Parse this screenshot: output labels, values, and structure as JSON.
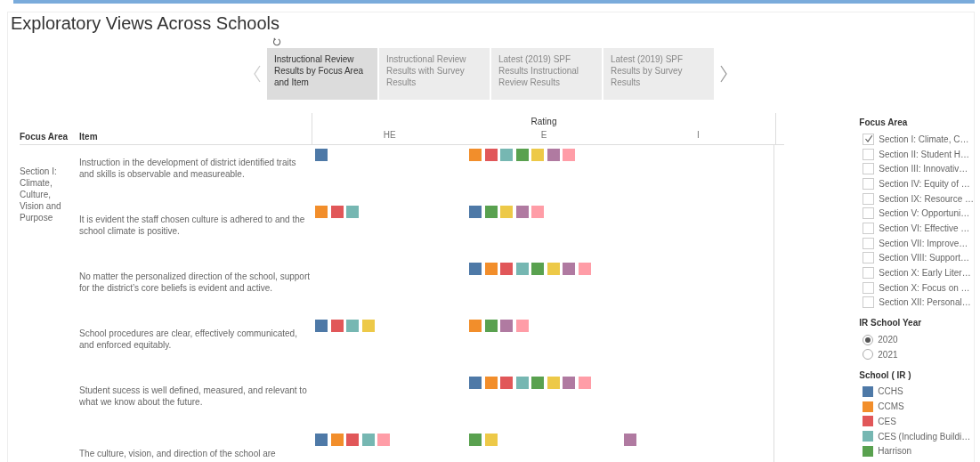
{
  "title": "Exploratory Views Across Schools",
  "tabs": [
    {
      "label": "Instructional Review Results by Focus Area and Item",
      "selected": true
    },
    {
      "label": "Instructional Review Results with Survey Results",
      "selected": false
    },
    {
      "label": "Latest (2019) SPF Results Instructional Review Results",
      "selected": false
    },
    {
      "label": "Latest (2019) SPF Results by Survey Results",
      "selected": false
    }
  ],
  "table": {
    "columns": [
      "Focus Area",
      "Item"
    ],
    "rating_header": "Rating",
    "ratings": {
      "he": "HE",
      "e": "E",
      "i": "I"
    },
    "focus_area": "Section I: Climate, Culture, Vision and Purpose",
    "rows": [
      {
        "item": "Instruction in the development of district identified traits and skills is observable and measureable.",
        "marks": {
          "he": [
            {
              "color": "#4e79a7"
            }
          ],
          "e": [
            {
              "color": "#f28e2b"
            },
            {
              "color": "#e15759"
            },
            {
              "color": "#76b7b2"
            },
            {
              "color": "#59a14f"
            },
            {
              "color": "#edc948"
            },
            {
              "color": "#b07aa1"
            },
            {
              "color": "#ff9da7"
            }
          ]
        }
      },
      {
        "item": "It is evident the staff chosen culture is adhered to and the school climate is positive.",
        "marks": {
          "he": [
            {
              "color": "#f28e2b"
            },
            {
              "color": "#e15759"
            },
            {
              "color": "#76b7b2"
            }
          ],
          "e": [
            {
              "color": "#4e79a7"
            },
            {
              "color": "#59a14f"
            },
            {
              "color": "#edc948"
            },
            {
              "color": "#b07aa1"
            },
            {
              "color": "#ff9da7"
            }
          ]
        }
      },
      {
        "item": "No matter the personalized direction of the school, support for the district’s core beliefs is evident and active.",
        "marks": {
          "e": [
            {
              "color": "#4e79a7"
            },
            {
              "color": "#f28e2b"
            },
            {
              "color": "#e15759"
            },
            {
              "color": "#76b7b2"
            },
            {
              "color": "#59a14f"
            },
            {
              "color": "#edc948"
            },
            {
              "color": "#b07aa1"
            },
            {
              "color": "#ff9da7"
            }
          ]
        }
      },
      {
        "item": "School procedures are clear, effectively communicated, and enforced equitably.",
        "marks": {
          "he": [
            {
              "color": "#4e79a7"
            },
            {
              "color": "#e15759"
            },
            {
              "color": "#76b7b2"
            },
            {
              "color": "#edc948"
            }
          ],
          "e": [
            {
              "color": "#f28e2b"
            },
            {
              "color": "#59a14f"
            },
            {
              "color": "#b07aa1"
            },
            {
              "color": "#ff9da7"
            }
          ]
        }
      },
      {
        "item": "Student sucess is well defined, measured, and relevant to what we know about the future.",
        "marks": {
          "e": [
            {
              "color": "#4e79a7"
            },
            {
              "color": "#f28e2b"
            },
            {
              "color": "#e15759"
            },
            {
              "color": "#76b7b2"
            },
            {
              "color": "#59a14f"
            },
            {
              "color": "#edc948"
            },
            {
              "color": "#b07aa1"
            },
            {
              "color": "#ff9da7"
            }
          ]
        }
      },
      {
        "item": "The culture, vision, and direction of the school are",
        "marks": {
          "he": [
            {
              "color": "#4e79a7"
            },
            {
              "color": "#f28e2b"
            },
            {
              "color": "#e15759"
            },
            {
              "color": "#76b7b2"
            },
            {
              "color": "#ff9da7"
            }
          ],
          "e": [
            {
              "color": "#59a14f"
            },
            {
              "color": "#edc948"
            }
          ],
          "i": [
            {
              "color": "#b07aa1"
            }
          ]
        }
      }
    ]
  },
  "filters": {
    "focus_area": {
      "title": "Focus Area",
      "options": [
        {
          "label": "Section I: Climate, C…",
          "checked": true
        },
        {
          "label": "Section II: Student H…",
          "checked": false
        },
        {
          "label": "Section III: Innovativ…",
          "checked": false
        },
        {
          "label": "Section IV: Equity of …",
          "checked": false
        },
        {
          "label": "Section IX: Resource …",
          "checked": false
        },
        {
          "label": "Section V: Opportuni…",
          "checked": false
        },
        {
          "label": "Section VI: Effective …",
          "checked": false
        },
        {
          "label": "Section VII: Improve…",
          "checked": false
        },
        {
          "label": "Section VIII: Support…",
          "checked": false
        },
        {
          "label": "Section X: Early Liter…",
          "checked": false
        },
        {
          "label": "Section X: Focus on …",
          "checked": false
        },
        {
          "label": "Section XII: Personal…",
          "checked": false
        }
      ]
    },
    "school_year": {
      "title": "IR School Year",
      "options": [
        {
          "label": "2020",
          "selected": true
        },
        {
          "label": "2021",
          "selected": false
        }
      ]
    },
    "school": {
      "title": "School ( IR )",
      "items": [
        {
          "label": "CCHS",
          "color": "#4e79a7"
        },
        {
          "label": "CCMS",
          "color": "#f28e2b"
        },
        {
          "label": "CES",
          "color": "#e15759"
        },
        {
          "label": "CES (Including Buildi…",
          "color": "#76b7b2"
        },
        {
          "label": "Harrison",
          "color": "#59a14f"
        }
      ]
    }
  }
}
